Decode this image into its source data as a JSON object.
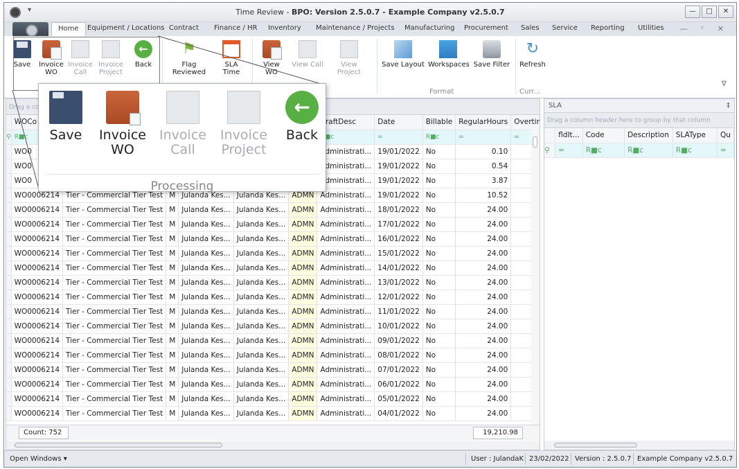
{
  "window": {
    "title_prefix": "Time Review - ",
    "title_bold": "BPO: Version 2.5.0.7 - Example Company v2.5.0.7",
    "qat": "▾",
    "minimize": "—",
    "maximize": "□",
    "close": "✕"
  },
  "tabs": [
    "Home",
    "Equipment / Locations",
    "Contract",
    "Finance / HR",
    "Inventory",
    "Maintenance / Projects",
    "Manufacturing",
    "Procurement",
    "Sales",
    "Service",
    "Reporting",
    "Utilities"
  ],
  "tab_controls": "— ᶜ ✕",
  "ribbon": {
    "save": "Save",
    "invoice_wo": "Invoice WO",
    "invoice_call": "Invoice Call",
    "invoice_project": "Invoice Project",
    "back": "Back",
    "flag_reviewed": "Flag Reviewed",
    "sla_time": "SLA Time",
    "view_wo": "View WO",
    "view_call": "View Call",
    "view_project": "View Project",
    "save_layout": "Save Layout",
    "workspaces": "Workspaces",
    "save_filter": "Save Filter",
    "refresh": "Refresh",
    "group_format": "Format",
    "group_curr": "Curr...",
    "collapse": "∇"
  },
  "zoom": {
    "save": "Save",
    "invoice_wo_1": "Invoice",
    "invoice_wo_2": "WO",
    "invoice_call_1": "Invoice",
    "invoice_call_2": "Call",
    "invoice_project_1": "Invoice",
    "invoice_project_2": "Project",
    "back": "Back",
    "group": "Processing"
  },
  "grid": {
    "group_hint": "Drag a co",
    "columns": [
      "WOCo",
      "",
      "",
      "",
      "",
      "",
      "CraftDesc",
      "Date",
      "Billable",
      "RegularHours",
      "Overtin"
    ],
    "filter_row": [
      "R■c",
      "",
      "",
      "",
      "",
      "",
      "R■c",
      "=",
      "R■c",
      "=",
      "="
    ],
    "rows": [
      [
        "WO0",
        "",
        "",
        "",
        "",
        "",
        "Administrati...",
        "19/01/2022",
        "No",
        "0.10"
      ],
      [
        "WO0",
        "",
        "",
        "",
        "",
        "",
        "Administrati...",
        "19/01/2022",
        "No",
        "0.54"
      ],
      [
        "WO0",
        "",
        "",
        "",
        "",
        "",
        "Administrati...",
        "19/01/2022",
        "No",
        "3.87"
      ],
      [
        "WO0006214",
        "Tier - Commercial Tier Test",
        "M",
        "Julanda Kes...",
        "Julanda Kes...",
        "ADMN",
        "Administrati...",
        "19/01/2022",
        "No",
        "10.52"
      ],
      [
        "WO0006214",
        "Tier - Commercial Tier Test",
        "M",
        "Julanda Kes...",
        "Julanda Kes...",
        "ADMN",
        "Administrati...",
        "18/01/2022",
        "No",
        "24.00"
      ],
      [
        "WO0006214",
        "Tier - Commercial Tier Test",
        "M",
        "Julanda Kes...",
        "Julanda Kes...",
        "ADMN",
        "Administrati...",
        "17/01/2022",
        "No",
        "24.00"
      ],
      [
        "WO0006214",
        "Tier - Commercial Tier Test",
        "M",
        "Julanda Kes...",
        "Julanda Kes...",
        "ADMN",
        "Administrati...",
        "16/01/2022",
        "No",
        "24.00"
      ],
      [
        "WO0006214",
        "Tier - Commercial Tier Test",
        "M",
        "Julanda Kes...",
        "Julanda Kes...",
        "ADMN",
        "Administrati...",
        "15/01/2022",
        "No",
        "24.00"
      ],
      [
        "WO0006214",
        "Tier - Commercial Tier Test",
        "M",
        "Julanda Kes...",
        "Julanda Kes...",
        "ADMN",
        "Administrati...",
        "14/01/2022",
        "No",
        "24.00"
      ],
      [
        "WO0006214",
        "Tier - Commercial Tier Test",
        "M",
        "Julanda Kes...",
        "Julanda Kes...",
        "ADMN",
        "Administrati...",
        "13/01/2022",
        "No",
        "24.00"
      ],
      [
        "WO0006214",
        "Tier - Commercial Tier Test",
        "M",
        "Julanda Kes...",
        "Julanda Kes...",
        "ADMN",
        "Administrati...",
        "12/01/2022",
        "No",
        "24.00"
      ],
      [
        "WO0006214",
        "Tier - Commercial Tier Test",
        "M",
        "Julanda Kes...",
        "Julanda Kes...",
        "ADMN",
        "Administrati...",
        "11/01/2022",
        "No",
        "24.00"
      ],
      [
        "WO0006214",
        "Tier - Commercial Tier Test",
        "M",
        "Julanda Kes...",
        "Julanda Kes...",
        "ADMN",
        "Administrati...",
        "10/01/2022",
        "No",
        "24.00"
      ],
      [
        "WO0006214",
        "Tier - Commercial Tier Test",
        "M",
        "Julanda Kes...",
        "Julanda Kes...",
        "ADMN",
        "Administrati...",
        "09/01/2022",
        "No",
        "24.00"
      ],
      [
        "WO0006214",
        "Tier - Commercial Tier Test",
        "M",
        "Julanda Kes...",
        "Julanda Kes...",
        "ADMN",
        "Administrati...",
        "08/01/2022",
        "No",
        "24.00"
      ],
      [
        "WO0006214",
        "Tier - Commercial Tier Test",
        "M",
        "Julanda Kes...",
        "Julanda Kes...",
        "ADMN",
        "Administrati...",
        "07/01/2022",
        "No",
        "24.00"
      ],
      [
        "WO0006214",
        "Tier - Commercial Tier Test",
        "M",
        "Julanda Kes...",
        "Julanda Kes...",
        "ADMN",
        "Administrati...",
        "06/01/2022",
        "No",
        "24.00"
      ],
      [
        "WO0006214",
        "Tier - Commercial Tier Test",
        "M",
        "Julanda Kes...",
        "Julanda Kes...",
        "ADMN",
        "Administrati...",
        "05/01/2022",
        "No",
        "24.00"
      ],
      [
        "WO0006214",
        "Tier - Commercial Tier Test",
        "M",
        "Julanda Kes...",
        "Julanda Kes...",
        "ADMN",
        "Administrati...",
        "04/01/2022",
        "No",
        "24.00"
      ]
    ],
    "count": "Count: 752",
    "sum_regular_hours": "19,210.98"
  },
  "sla": {
    "title": "SLA",
    "pin": "‡",
    "group_hint": "Drag a column header here to group by that column",
    "columns": [
      "fldIt...",
      "Code",
      "Description",
      "SLAType",
      "Qu"
    ],
    "filter_row": [
      "=",
      "R■c",
      "R■c",
      "R■c",
      "="
    ]
  },
  "status": {
    "open_windows": "Open Windows ▾",
    "user": "User : JulandaK",
    "date": "23/02/2022",
    "version": "Version : 2.5.0.7",
    "company": "Example Company v2.5.0.7"
  }
}
